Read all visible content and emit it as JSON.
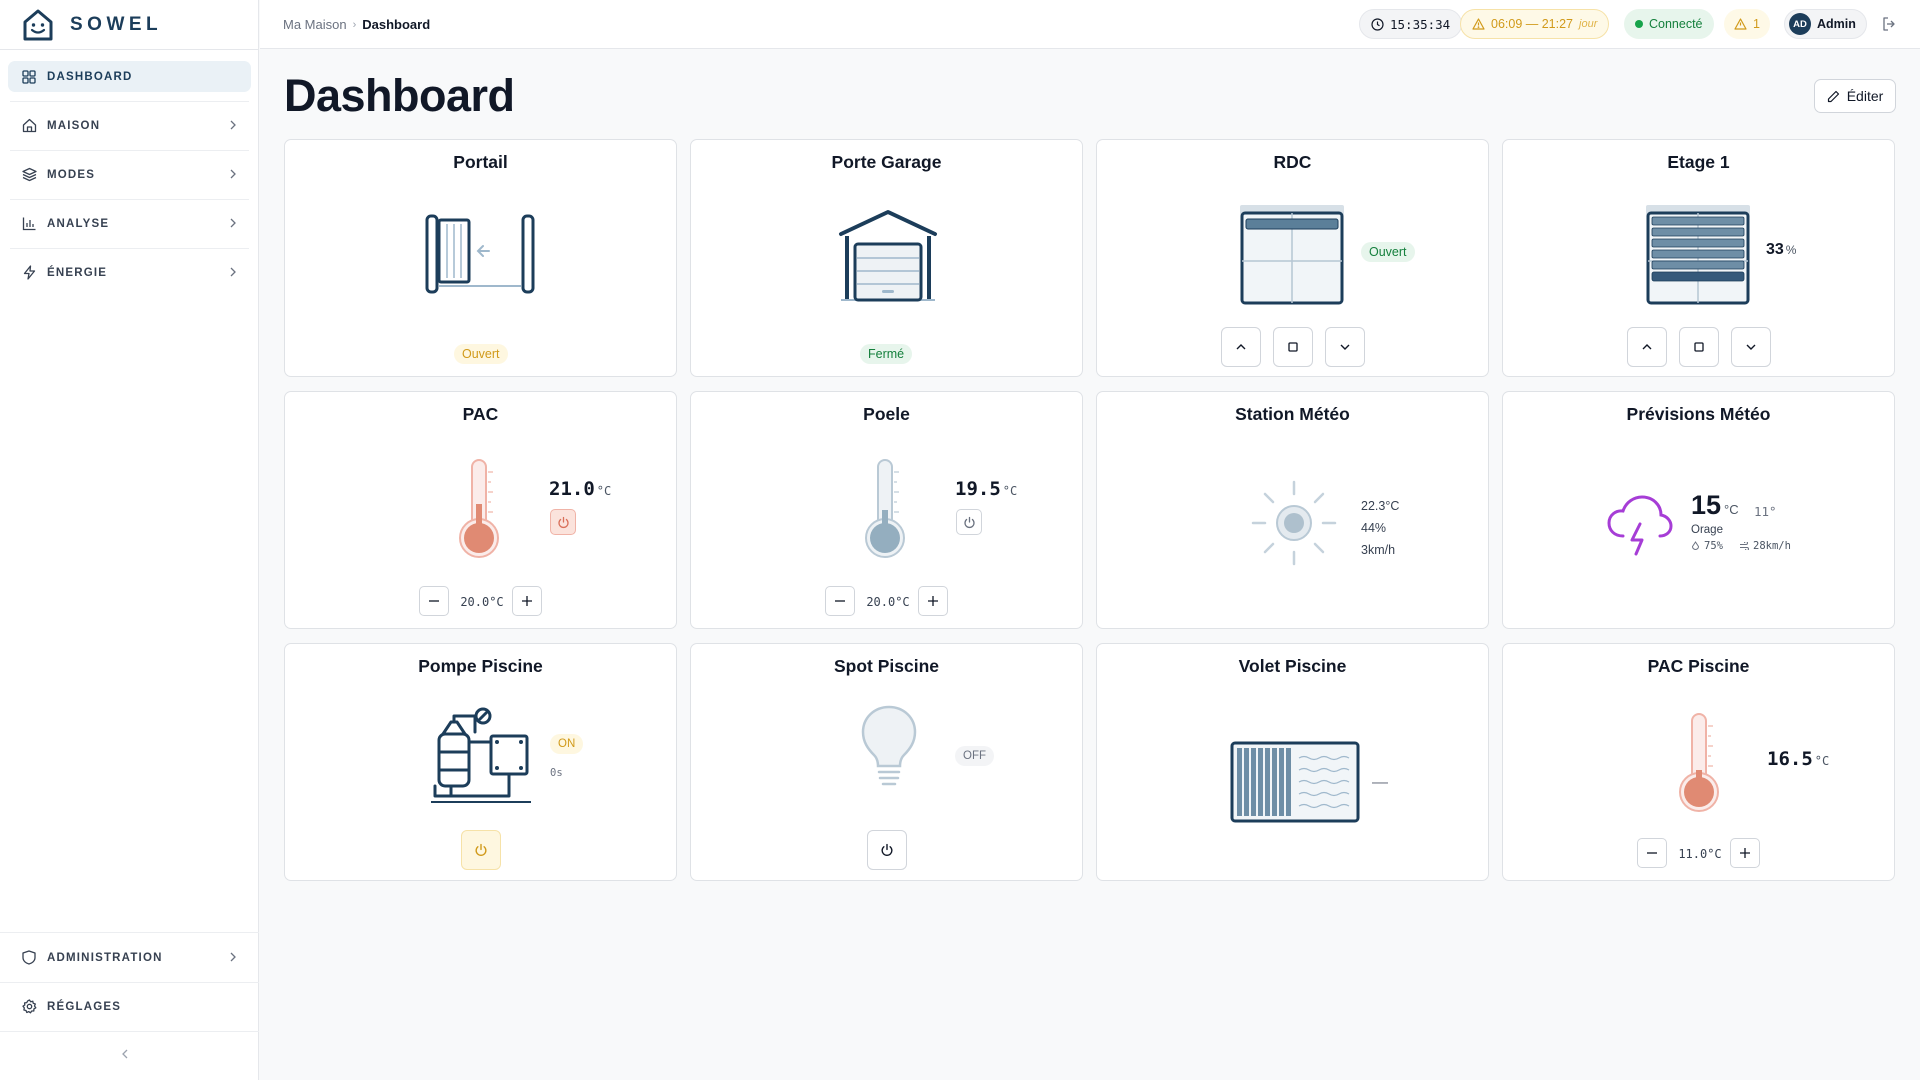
{
  "app": {
    "name": "SOWEL"
  },
  "sidebar": {
    "items": [
      {
        "label": "DASHBOARD",
        "icon": "dashboard-grid-icon",
        "active": true
      },
      {
        "label": "MAISON",
        "icon": "home-icon"
      },
      {
        "label": "MODES",
        "icon": "layers-icon"
      },
      {
        "label": "ANALYSE",
        "icon": "bar-chart-icon"
      },
      {
        "label": "ÉNERGIE",
        "icon": "lightning-icon"
      }
    ],
    "bottom": [
      {
        "label": "ADMINISTRATION",
        "icon": "shield-icon"
      },
      {
        "label": "RÉGLAGES",
        "icon": "gear-icon"
      }
    ]
  },
  "header": {
    "breadcrumb": [
      "Ma Maison",
      "Dashboard"
    ],
    "time": "15:35:34",
    "sun": "06:09 — 21:27",
    "sun_mode": "jour",
    "status": "Connecté",
    "alerts": "1",
    "user_initials": "AD",
    "user_name": "Admin"
  },
  "page": {
    "title": "Dashboard",
    "edit_label": "Éditer"
  },
  "cards": {
    "portail": {
      "title": "Portail",
      "status": "Ouvert"
    },
    "garage": {
      "title": "Porte Garage",
      "status": "Fermé"
    },
    "rdc": {
      "title": "RDC",
      "status": "Ouvert"
    },
    "etage": {
      "title": "Etage 1",
      "value": "33",
      "unit": "%"
    },
    "pac": {
      "title": "PAC",
      "temp": "21.0",
      "unit": "°C",
      "setpoint": "20.0°C"
    },
    "poele": {
      "title": "Poele",
      "temp": "19.5",
      "unit": "°C",
      "setpoint": "20.0°C"
    },
    "station": {
      "title": "Station Météo",
      "temp": "22.3°C",
      "humidity": "44%",
      "wind": "3km/h"
    },
    "previsions": {
      "title": "Prévisions Météo",
      "temp": "15",
      "unit": "°C",
      "temp_min": "11°",
      "condition": "Orage",
      "rain": "75%",
      "wind": "28km/h"
    },
    "pompe": {
      "title": "Pompe Piscine",
      "state": "ON",
      "duration": "0s"
    },
    "spot": {
      "title": "Spot Piscine",
      "state": "OFF"
    },
    "volet_piscine": {
      "title": "Volet Piscine",
      "value": "—"
    },
    "pac_piscine": {
      "title": "PAC Piscine",
      "temp": "16.5",
      "unit": "°C",
      "setpoint": "11.0°C"
    }
  },
  "colors": {
    "brand": "#1c3d5a",
    "open_badge": "#fef7e0",
    "closed_badge": "#e7f5ec",
    "connected": "#16a34a",
    "warm": "#e08a73",
    "storm": "#a63dd6"
  }
}
